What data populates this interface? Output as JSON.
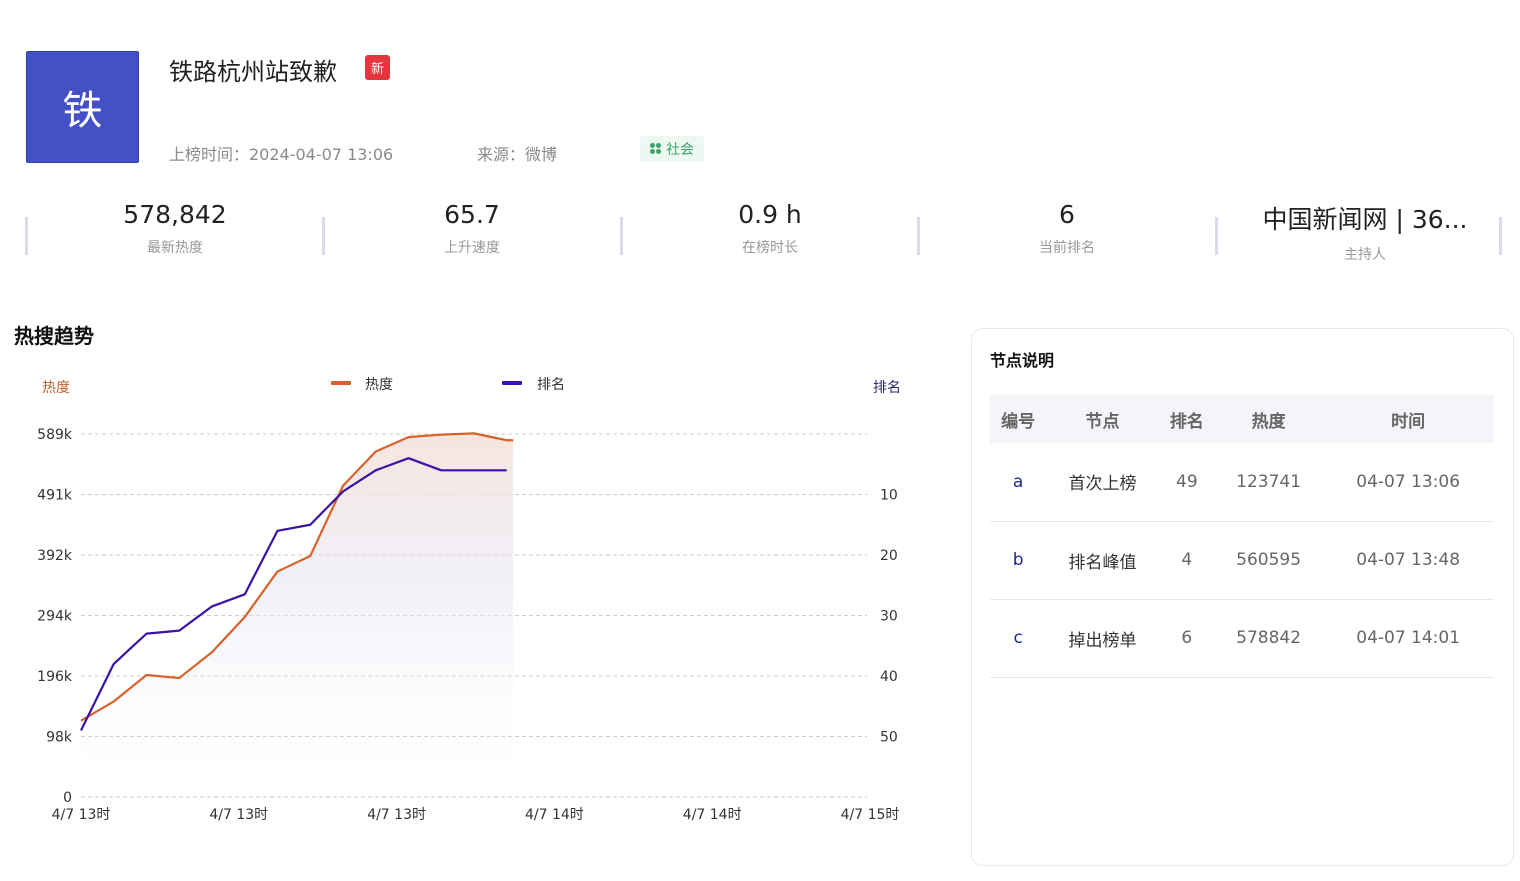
{
  "header": {
    "avatar_char": "铁",
    "title": "铁路杭州站致歉",
    "new_badge": "新",
    "list_time_label": "上榜时间：2024-04-07 13:06",
    "source_label": "来源：微博",
    "category": "社会"
  },
  "stats": [
    {
      "value": "578,842",
      "label": "最新热度"
    },
    {
      "value": "65.7",
      "label": "上升速度"
    },
    {
      "value": "0.9 h",
      "label": "在榜时长"
    },
    {
      "value": "6",
      "label": "当前排名"
    },
    {
      "value": "中国新闻网 | 36...",
      "label": "主持人"
    }
  ],
  "trend": {
    "title": "热搜趋势"
  },
  "chart_data": {
    "type": "line",
    "left_axis_label": "热度",
    "right_axis_label": "排名",
    "left_ticks": [
      "589k",
      "491k",
      "392k",
      "294k",
      "196k",
      "98k",
      "0"
    ],
    "right_ticks": [
      "10",
      "20",
      "30",
      "40",
      "50"
    ],
    "x_tick_labels": [
      "4/7 13时",
      "4/7 13时",
      "4/7 13时",
      "4/7 14时",
      "4/7 14时",
      "4/7 15时"
    ],
    "heat_ylim": [
      0,
      589000
    ],
    "rank_ylim": [
      0,
      60
    ],
    "xlim": [
      0,
      24
    ],
    "series": [
      {
        "name": "热度",
        "color": "#d8622a",
        "x": [
          0,
          1,
          2,
          3,
          4,
          5,
          6,
          7,
          8,
          9,
          10,
          11,
          12,
          13,
          13.2
        ],
        "values": [
          123741,
          155000,
          198000,
          193000,
          235000,
          292000,
          366000,
          391000,
          505000,
          560595,
          584000,
          588000,
          590000,
          578842,
          578842
        ]
      },
      {
        "name": "排名",
        "color": "#3a12a8",
        "x": [
          0,
          1,
          2,
          3,
          4,
          5,
          6,
          7,
          8,
          9,
          10,
          11,
          12,
          13
        ],
        "values": [
          49,
          38,
          33,
          32.5,
          28.5,
          26.5,
          16,
          15,
          9.5,
          6,
          4,
          6,
          6,
          6
        ]
      }
    ],
    "grid": true,
    "legend": "top-center"
  },
  "nodes": {
    "title": "节点说明",
    "headers": [
      "编号",
      "节点",
      "排名",
      "热度",
      "时间"
    ],
    "rows": [
      {
        "code": "a",
        "node": "首次上榜",
        "rank": "49",
        "heat": "123741",
        "time": "04-07 13:06"
      },
      {
        "code": "b",
        "node": "排名峰值",
        "rank": "4",
        "heat": "560595",
        "time": "04-07 13:48"
      },
      {
        "code": "c",
        "node": "掉出榜单",
        "rank": "6",
        "heat": "578842",
        "time": "04-07 14:01"
      }
    ]
  }
}
